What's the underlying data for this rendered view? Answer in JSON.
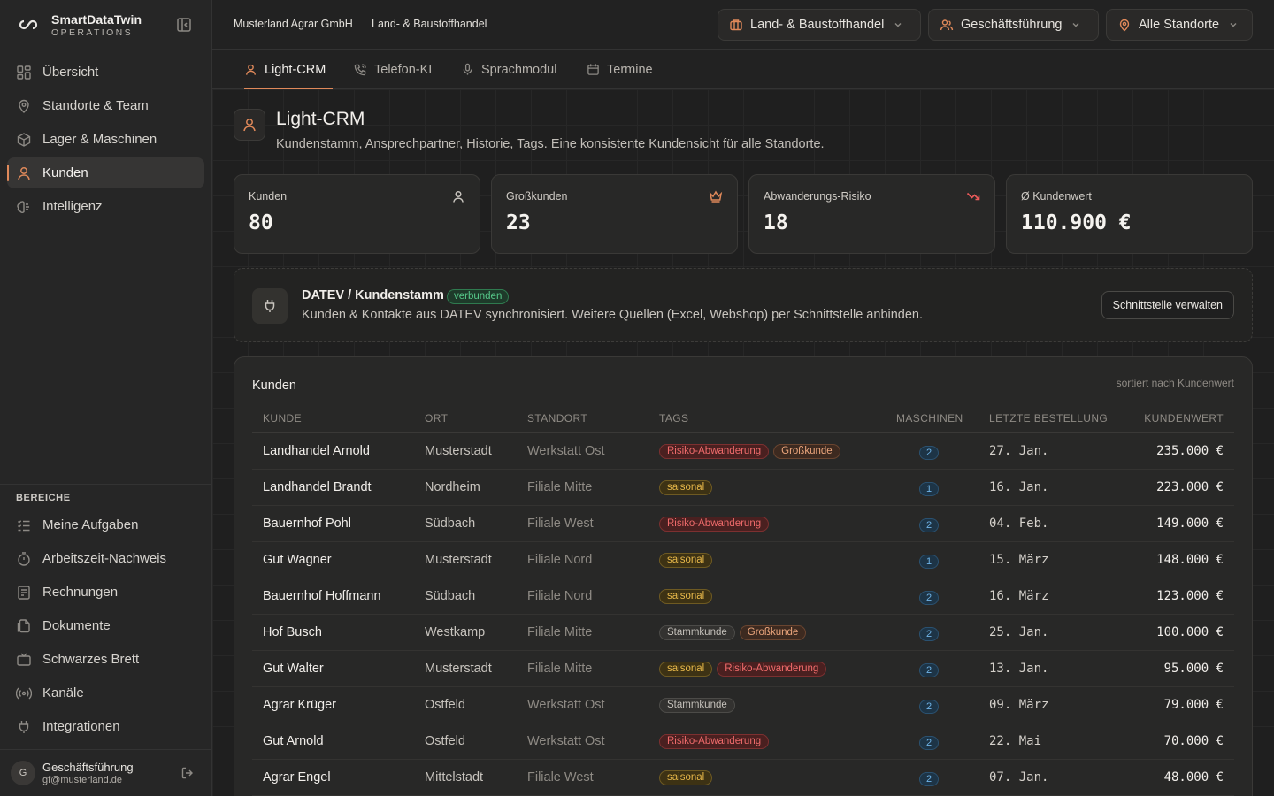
{
  "brand": {
    "name": "SmartDataTwin",
    "sub": "OPERATIONS"
  },
  "nav": [
    {
      "label": "Übersicht",
      "icon": "grid-icon",
      "active": false
    },
    {
      "label": "Standorte & Team",
      "icon": "map-pin-icon",
      "active": false
    },
    {
      "label": "Lager & Maschinen",
      "icon": "box-icon",
      "active": false
    },
    {
      "label": "Kunden",
      "icon": "user-icon",
      "active": true
    },
    {
      "label": "Intelligenz",
      "icon": "brain-icon",
      "active": false
    }
  ],
  "bereiche": {
    "label": "BEREICHE",
    "items": [
      {
        "label": "Meine Aufgaben",
        "icon": "tasks-icon"
      },
      {
        "label": "Arbeitszeit-Nachweis",
        "icon": "timer-icon"
      },
      {
        "label": "Rechnungen",
        "icon": "receipt-icon"
      },
      {
        "label": "Dokumente",
        "icon": "documents-icon"
      },
      {
        "label": "Schwarzes Brett",
        "icon": "tv-icon"
      },
      {
        "label": "Kanäle",
        "icon": "radio-icon"
      },
      {
        "label": "Integrationen",
        "icon": "plug-icon"
      }
    ]
  },
  "user": {
    "initial": "G",
    "name": "Geschäftsführung",
    "email": "gf@musterland.de"
  },
  "breadcrumb": {
    "company": "Musterland Agrar GmbH",
    "branch": "Land- & Baustoffhandel"
  },
  "selectors": [
    {
      "label": "Land- & Baustoffhandel",
      "icon": "briefcase-icon"
    },
    {
      "label": "Geschäftsführung",
      "icon": "users-icon"
    },
    {
      "label": "Alle Standorte",
      "icon": "map-pin-icon"
    }
  ],
  "tabs": [
    {
      "label": "Light-CRM",
      "icon": "user-icon",
      "active": true
    },
    {
      "label": "Telefon-KI",
      "icon": "phone-icon",
      "active": false
    },
    {
      "label": "Sprachmodul",
      "icon": "mic-icon",
      "active": false
    },
    {
      "label": "Termine",
      "icon": "calendar-icon",
      "active": false
    }
  ],
  "page": {
    "title": "Light-CRM",
    "subtitle": "Kundenstamm, Ansprechpartner, Historie, Tags. Eine konsistente Kundensicht für alle Standorte."
  },
  "kpis": [
    {
      "label": "Kunden",
      "value": "80",
      "icon": "user-icon",
      "icon_color": "#c9c5bf"
    },
    {
      "label": "Großkunden",
      "value": "23",
      "icon": "crown-icon",
      "icon_color": "#e0895a"
    },
    {
      "label": "Abwanderungs-Risiko",
      "value": "18",
      "icon": "trend-down-icon",
      "icon_color": "#ef5b5b"
    },
    {
      "label": "Ø Kundenwert",
      "value": "110.900 €",
      "icon": "",
      "icon_color": ""
    }
  ],
  "datev": {
    "title": "DATEV / Kundenstamm",
    "badge": "verbunden",
    "description": "Kunden & Kontakte aus DATEV synchronisiert. Weitere Quellen (Excel, Webshop) per Schnittstelle anbinden.",
    "button": "Schnittstelle verwalten"
  },
  "customers": {
    "title": "Kunden",
    "sort_note": "sortiert nach Kundenwert",
    "columns": [
      "KUNDE",
      "ORT",
      "STANDORT",
      "TAGS",
      "MASCHINEN",
      "LETZTE BESTELLUNG",
      "KUNDENWERT"
    ],
    "rows": [
      {
        "name": "Landhandel Arnold",
        "ort": "Musterstadt",
        "standort": "Werkstatt Ost",
        "tags": [
          "Risiko-Abwanderung",
          "Großkunde"
        ],
        "maschinen": "2",
        "last": "27. Jan.",
        "wert": "235.000 €"
      },
      {
        "name": "Landhandel Brandt",
        "ort": "Nordheim",
        "standort": "Filiale Mitte",
        "tags": [
          "saisonal"
        ],
        "maschinen": "1",
        "last": "16. Jan.",
        "wert": "223.000 €"
      },
      {
        "name": "Bauernhof Pohl",
        "ort": "Südbach",
        "standort": "Filiale West",
        "tags": [
          "Risiko-Abwanderung"
        ],
        "maschinen": "2",
        "last": "04. Feb.",
        "wert": "149.000 €"
      },
      {
        "name": "Gut Wagner",
        "ort": "Musterstadt",
        "standort": "Filiale Nord",
        "tags": [
          "saisonal"
        ],
        "maschinen": "1",
        "last": "15. März",
        "wert": "148.000 €"
      },
      {
        "name": "Bauernhof Hoffmann",
        "ort": "Südbach",
        "standort": "Filiale Nord",
        "tags": [
          "saisonal"
        ],
        "maschinen": "2",
        "last": "16. März",
        "wert": "123.000 €"
      },
      {
        "name": "Hof Busch",
        "ort": "Westkamp",
        "standort": "Filiale Mitte",
        "tags": [
          "Stammkunde",
          "Großkunde"
        ],
        "maschinen": "2",
        "last": "25. Jan.",
        "wert": "100.000 €"
      },
      {
        "name": "Gut Walter",
        "ort": "Musterstadt",
        "standort": "Filiale Mitte",
        "tags": [
          "saisonal",
          "Risiko-Abwanderung"
        ],
        "maschinen": "2",
        "last": "13. Jan.",
        "wert": "95.000 €"
      },
      {
        "name": "Agrar Krüger",
        "ort": "Ostfeld",
        "standort": "Werkstatt Ost",
        "tags": [
          "Stammkunde"
        ],
        "maschinen": "2",
        "last": "09. März",
        "wert": "79.000 €"
      },
      {
        "name": "Gut Arnold",
        "ort": "Ostfeld",
        "standort": "Werkstatt Ost",
        "tags": [
          "Risiko-Abwanderung"
        ],
        "maschinen": "2",
        "last": "22. Mai",
        "wert": "70.000 €"
      },
      {
        "name": "Agrar Engel",
        "ort": "Mittelstadt",
        "standort": "Filiale West",
        "tags": [
          "saisonal"
        ],
        "maschinen": "2",
        "last": "07. Jan.",
        "wert": "48.000 €"
      }
    ]
  },
  "colors": {
    "accent": "#e0895a",
    "success": "#57c98a",
    "danger": "#ef6b6b",
    "warning": "#e7b84a",
    "info": "#6fb3e6"
  }
}
